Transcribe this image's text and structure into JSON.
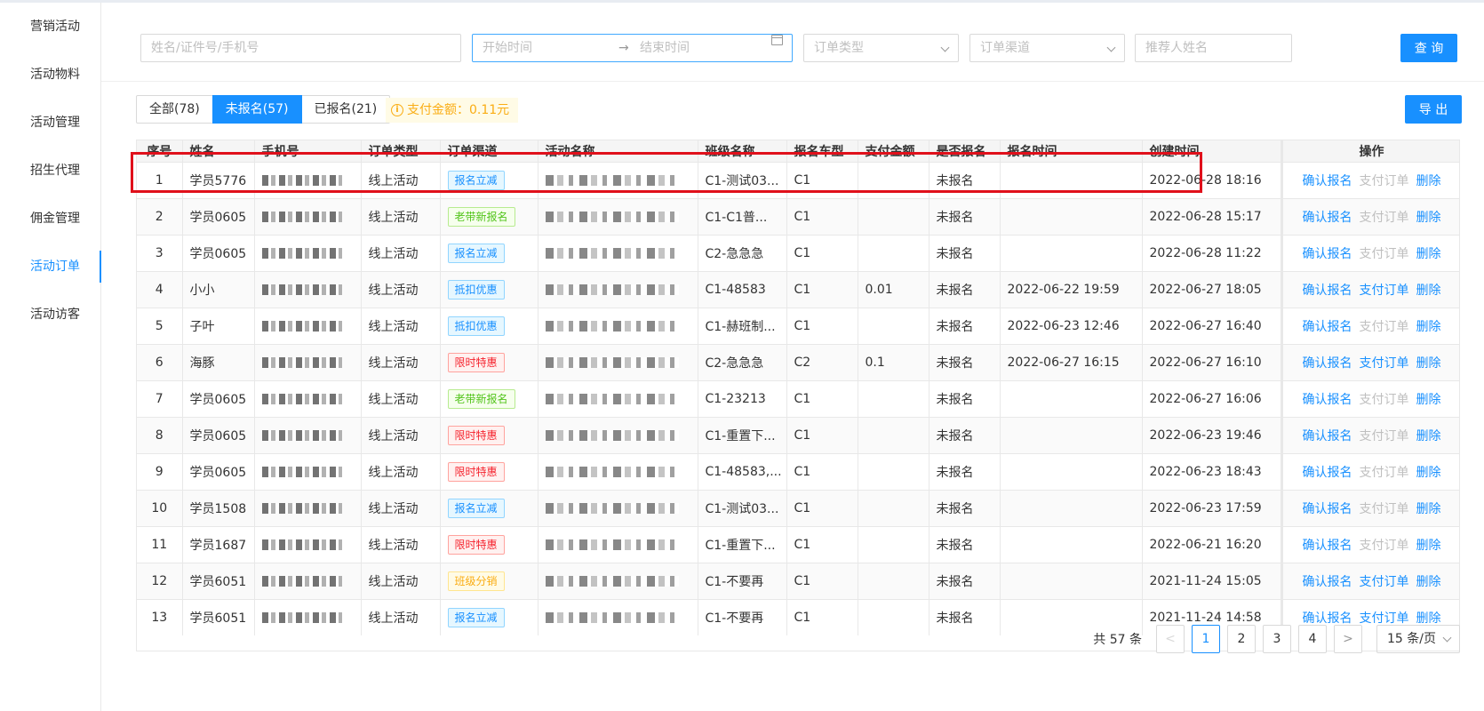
{
  "sidebar": {
    "items": [
      {
        "label": "营销活动"
      },
      {
        "label": "活动物料"
      },
      {
        "label": "活动管理"
      },
      {
        "label": "招生代理"
      },
      {
        "label": "佣金管理"
      },
      {
        "label": "活动订单",
        "active": true
      },
      {
        "label": "活动访客"
      }
    ]
  },
  "filters": {
    "keyword_placeholder": "姓名/证件号/手机号",
    "start_placeholder": "开始时间",
    "end_placeholder": "结束时间",
    "range_arrow": "→",
    "order_type_placeholder": "订单类型",
    "order_channel_placeholder": "订单渠道",
    "referrer_placeholder": "推荐人姓名",
    "query_label": "查 询"
  },
  "tabs": [
    {
      "label": "全部(78)"
    },
    {
      "label": "未报名(57)",
      "active": true
    },
    {
      "label": "已报名(21)"
    }
  ],
  "pay_total": "支付金额：0.11元",
  "info_icon": "i",
  "export_label": "导 出",
  "table": {
    "columns": [
      "序号",
      "姓名",
      "手机号",
      "订单类型",
      "订单渠道",
      "活动名称",
      "班级名称",
      "报名车型",
      "支付金额",
      "是否报名",
      "报名时间",
      "创建时间",
      "操作"
    ],
    "action_labels": {
      "confirm": "确认报名",
      "pay": "支付订单",
      "delete": "删除"
    },
    "rows": [
      {
        "idx": "1",
        "name": "学员5776",
        "type": "线上活动",
        "channel": "报名立减",
        "tag_color": "blue",
        "class_name": "C1-测试03...",
        "car": "C1",
        "amount": "",
        "enrolled": "未报名",
        "enroll_time": "",
        "created": "2022-06-28 18:16",
        "pay_enabled": false
      },
      {
        "idx": "2",
        "name": "学员0605",
        "type": "线上活动",
        "channel": "老带新报名",
        "tag_color": "green",
        "class_name": "C1-C1普...",
        "car": "C1",
        "amount": "",
        "enrolled": "未报名",
        "enroll_time": "",
        "created": "2022-06-28 15:17",
        "pay_enabled": false
      },
      {
        "idx": "3",
        "name": "学员0605",
        "type": "线上活动",
        "channel": "报名立减",
        "tag_color": "blue",
        "class_name": "C2-急急急",
        "car": "C1",
        "amount": "",
        "enrolled": "未报名",
        "enroll_time": "",
        "created": "2022-06-28 11:22",
        "pay_enabled": false
      },
      {
        "idx": "4",
        "name": "小小",
        "type": "线上活动",
        "channel": "抵扣优惠",
        "tag_color": "blue",
        "class_name": "C1-48583",
        "car": "C1",
        "amount": "0.01",
        "enrolled": "未报名",
        "enroll_time": "2022-06-22 19:59",
        "created": "2022-06-27 18:05",
        "pay_enabled": true
      },
      {
        "idx": "5",
        "name": "子叶",
        "type": "线上活动",
        "channel": "抵扣优惠",
        "tag_color": "blue",
        "class_name": "C1-赫班制...",
        "car": "C1",
        "amount": "",
        "enrolled": "未报名",
        "enroll_time": "2022-06-23 12:46",
        "created": "2022-06-27 16:40",
        "pay_enabled": false
      },
      {
        "idx": "6",
        "name": "海豚",
        "type": "线上活动",
        "channel": "限时特惠",
        "tag_color": "red",
        "class_name": "C2-急急急",
        "car": "C2",
        "amount": "0.1",
        "enrolled": "未报名",
        "enroll_time": "2022-06-27 16:15",
        "created": "2022-06-27 16:10",
        "pay_enabled": true
      },
      {
        "idx": "7",
        "name": "学员0605",
        "type": "线上活动",
        "channel": "老带新报名",
        "tag_color": "green",
        "class_name": "C1-23213",
        "car": "C1",
        "amount": "",
        "enrolled": "未报名",
        "enroll_time": "",
        "created": "2022-06-27 16:06",
        "pay_enabled": false
      },
      {
        "idx": "8",
        "name": "学员0605",
        "type": "线上活动",
        "channel": "限时特惠",
        "tag_color": "red",
        "class_name": "C1-重置下...",
        "car": "C1",
        "amount": "",
        "enrolled": "未报名",
        "enroll_time": "",
        "created": "2022-06-23 19:46",
        "pay_enabled": false
      },
      {
        "idx": "9",
        "name": "学员0605",
        "type": "线上活动",
        "channel": "限时特惠",
        "tag_color": "red",
        "class_name": "C1-48583,...",
        "car": "C1",
        "amount": "",
        "enrolled": "未报名",
        "enroll_time": "",
        "created": "2022-06-23 18:43",
        "pay_enabled": false
      },
      {
        "idx": "10",
        "name": "学员1508",
        "type": "线上活动",
        "channel": "报名立减",
        "tag_color": "blue",
        "class_name": "C1-测试03...",
        "car": "C1",
        "amount": "",
        "enrolled": "未报名",
        "enroll_time": "",
        "created": "2022-06-23 17:59",
        "pay_enabled": false
      },
      {
        "idx": "11",
        "name": "学员1687",
        "type": "线上活动",
        "channel": "限时特惠",
        "tag_color": "red",
        "class_name": "C1-重置下...",
        "car": "C1",
        "amount": "",
        "enrolled": "未报名",
        "enroll_time": "",
        "created": "2022-06-21 16:20",
        "pay_enabled": false
      },
      {
        "idx": "12",
        "name": "学员6051",
        "type": "线上活动",
        "channel": "班级分销",
        "tag_color": "gold",
        "class_name": "C1-不要再",
        "car": "C1",
        "amount": "",
        "enrolled": "未报名",
        "enroll_time": "",
        "created": "2021-11-24 15:05",
        "pay_enabled": true
      },
      {
        "idx": "13",
        "name": "学员6051",
        "type": "线上活动",
        "channel": "报名立减",
        "tag_color": "blue",
        "class_name": "C1-不要再",
        "car": "C1",
        "amount": "",
        "enrolled": "未报名",
        "enroll_time": "",
        "created": "2021-11-24 14:58",
        "pay_enabled": true
      }
    ]
  },
  "pagination": {
    "total": "共 57 条",
    "prev": "<",
    "next": ">",
    "pages": [
      "1",
      "2",
      "3",
      "4"
    ],
    "current": "1",
    "page_size": "15 条/页"
  },
  "colors": {
    "accent": "#1890ff",
    "highlight": "#e0101b",
    "warning": "#faad14"
  }
}
